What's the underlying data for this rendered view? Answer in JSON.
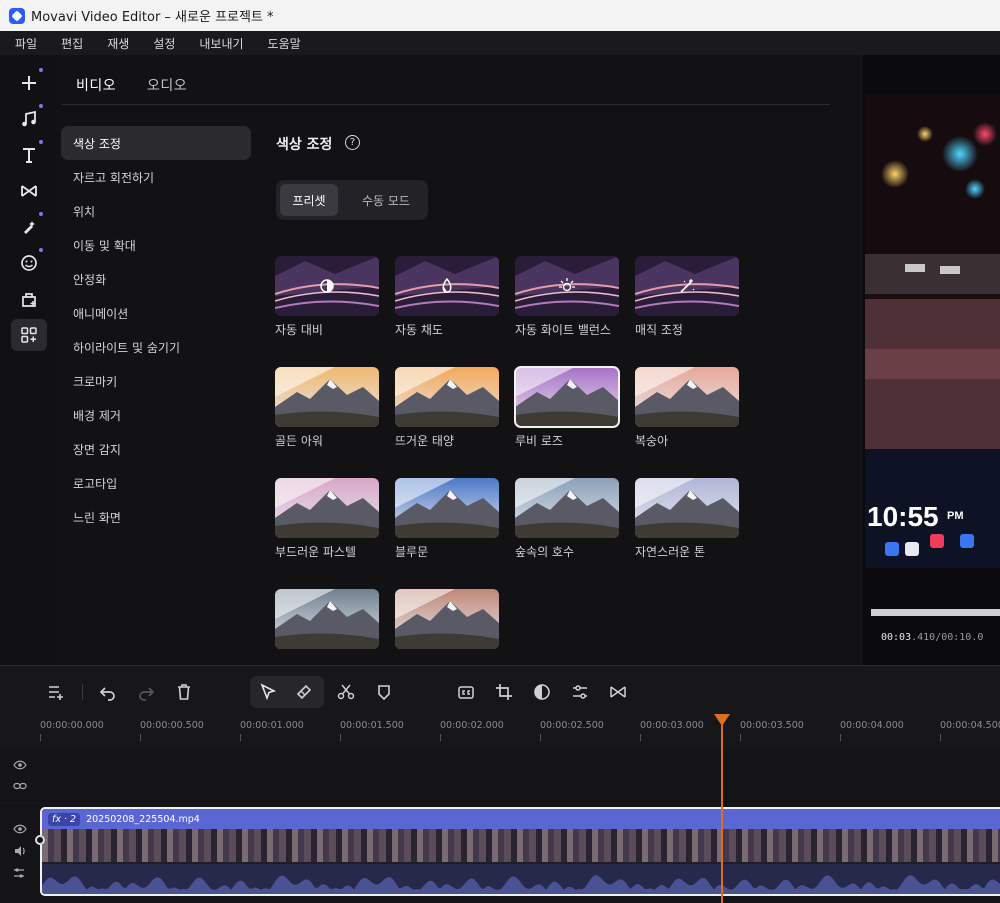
{
  "window": {
    "title": "Movavi Video Editor – 새로운 프로젝트 *"
  },
  "menu": [
    "파일",
    "편집",
    "재생",
    "설정",
    "내보내기",
    "도움말"
  ],
  "tools": [
    {
      "name": "add-icon",
      "active": false
    },
    {
      "name": "music-icon",
      "active": false
    },
    {
      "name": "text-icon",
      "active": false
    },
    {
      "name": "transitions-icon",
      "active": false
    },
    {
      "name": "effects-icon",
      "active": false
    },
    {
      "name": "stickers-icon",
      "active": false
    },
    {
      "name": "store-icon",
      "active": false
    },
    {
      "name": "more-tools-icon",
      "active": true
    }
  ],
  "tabs": {
    "video": "비디오",
    "audio": "오디오"
  },
  "categories": [
    "색상 조정",
    "자르고 회전하기",
    "위치",
    "이동 및 확대",
    "안정화",
    "애니메이션",
    "하이라이트 및 숨기기",
    "크로마키",
    "배경 제거",
    "장면 감지",
    "로고타입",
    "느린 화면"
  ],
  "selected_category": "색상 조정",
  "section": {
    "title": "색상 조정",
    "help": "?"
  },
  "modes": {
    "preset": "프리셋",
    "manual": "수동 모드"
  },
  "presets": [
    {
      "label": "자동 대비",
      "icon": "contrast-icon"
    },
    {
      "label": "자동 채도",
      "icon": "saturation-icon"
    },
    {
      "label": "자동 화이트 밸런스",
      "icon": "white-balance-icon"
    },
    {
      "label": "매직 조정",
      "icon": "magic-wand-icon"
    },
    {
      "label": "골든 아워",
      "tint": "#f0b870"
    },
    {
      "label": "뜨거운 태양",
      "tint": "#f3a95a"
    },
    {
      "label": "루비 로즈",
      "tint": "#a870c8",
      "selected": true
    },
    {
      "label": "복숭아",
      "tint": "#e8a898"
    },
    {
      "label": "부드러운 파스텔",
      "tint": "#d9a7c9"
    },
    {
      "label": "블루문",
      "tint": "#4c79c8"
    },
    {
      "label": "숲속의 호수",
      "tint": "#8aa0b8"
    },
    {
      "label": "자연스러운 톤",
      "tint": "#b0b6d8"
    },
    {
      "label": "",
      "tint": "#708090"
    },
    {
      "label": "",
      "tint": "#c08878"
    }
  ],
  "preview": {
    "timecode_current": "00:03",
    "timecode_fraction": ".410/00:10.0"
  },
  "ruler": [
    "00:00:00.000",
    "00:00:00.500",
    "00:00:01.000",
    "00:00:01.500",
    "00:00:02.000",
    "00:00:02.500",
    "00:00:03.000",
    "00:00:03.500",
    "00:00:04.000",
    "00:00:04.500"
  ],
  "clip": {
    "fx": "fx · 2",
    "name": "20250208_225504.mp4"
  },
  "colors": {
    "accent": "#e06d1f",
    "clip": "#5b66d4",
    "selection": "#8b6cff"
  }
}
